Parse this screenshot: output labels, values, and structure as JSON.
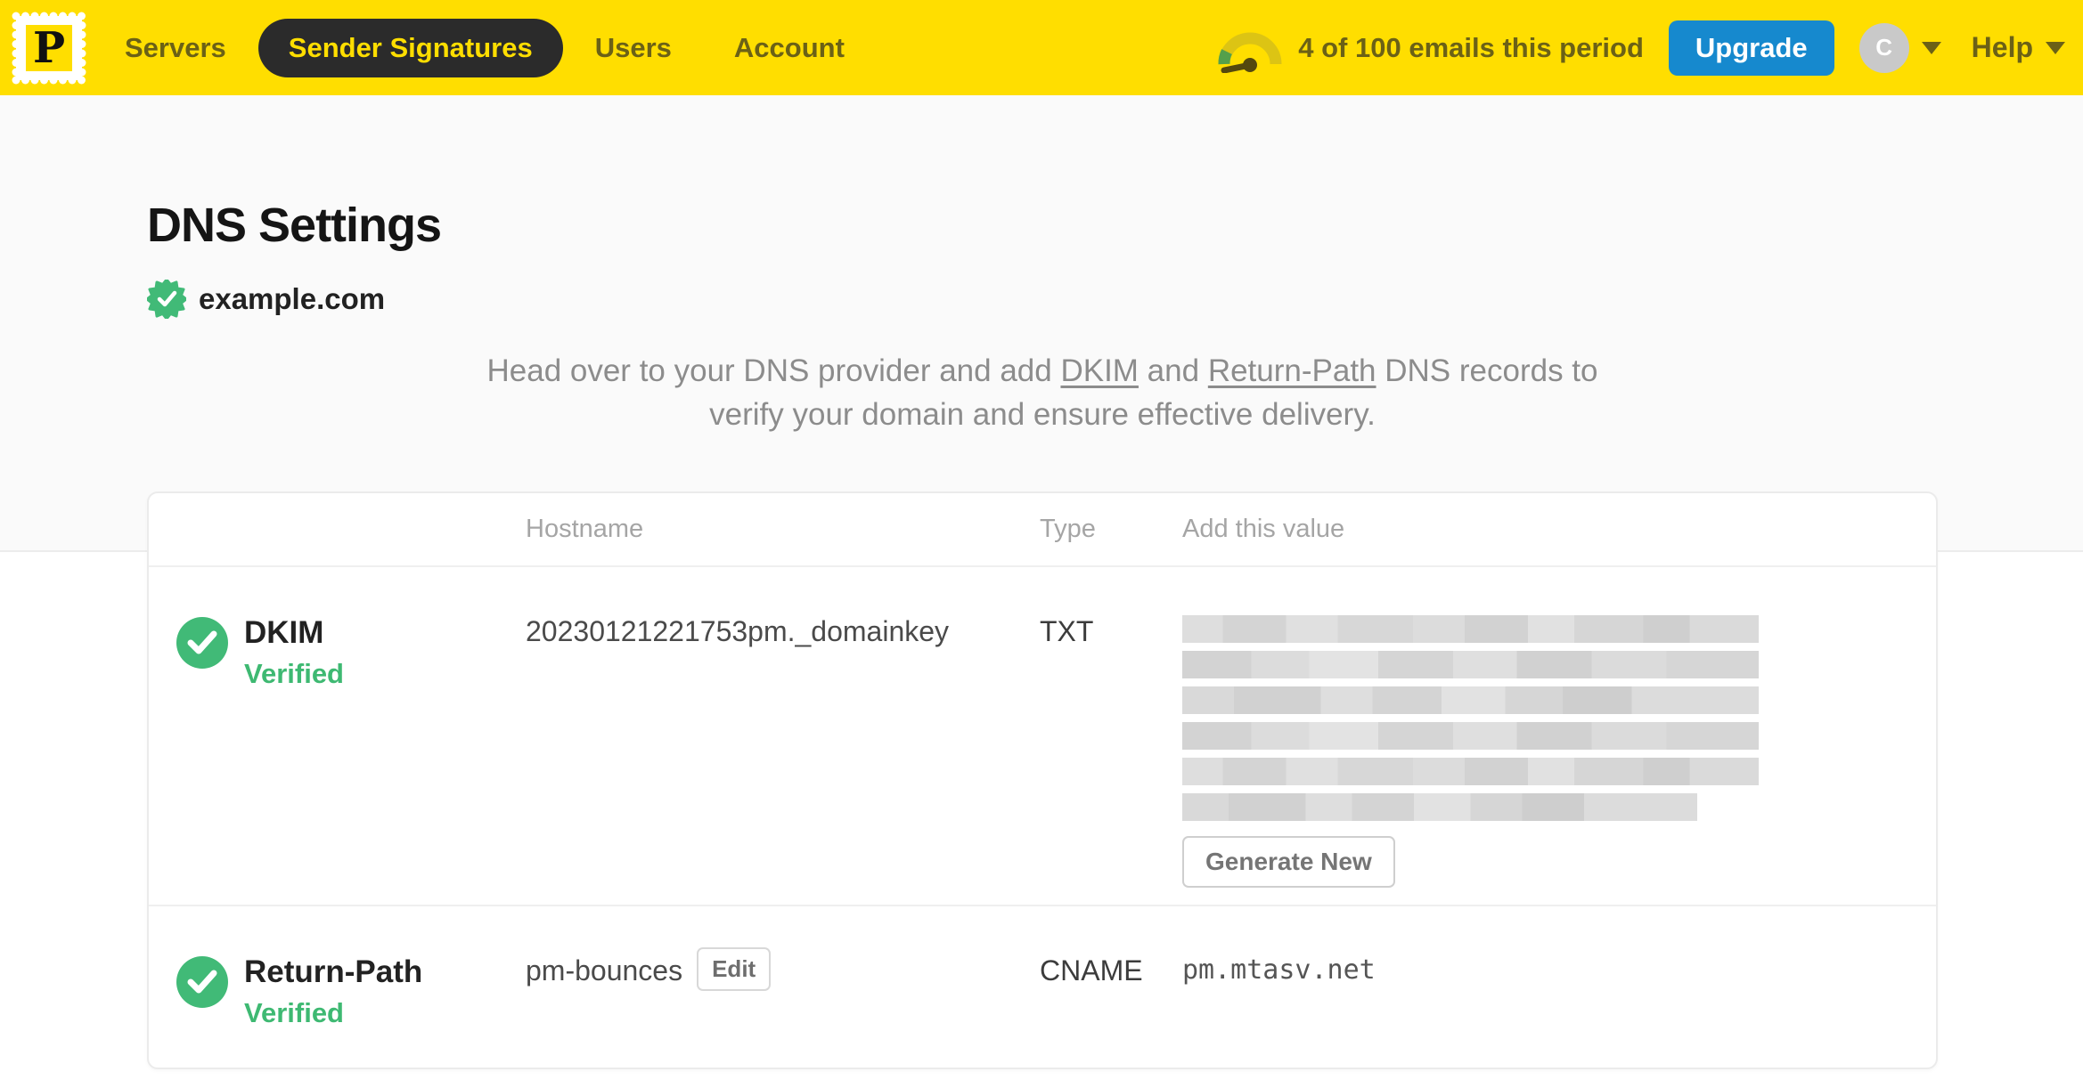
{
  "nav": {
    "logo_letter": "P",
    "items": [
      {
        "label": "Servers",
        "active": false
      },
      {
        "label": "Sender Signatures",
        "active": true
      },
      {
        "label": "Users",
        "active": false
      },
      {
        "label": "Account",
        "active": false
      }
    ],
    "usage_text": "4 of 100 emails this period",
    "upgrade_label": "Upgrade",
    "avatar_initial": "C",
    "help_label": "Help"
  },
  "page": {
    "title": "DNS Settings",
    "domain": "example.com",
    "instructions": {
      "part1": "Head over to your DNS provider and add ",
      "link1": "DKIM",
      "part2": " and ",
      "link2": "Return-Path",
      "part3": " DNS records to verify your domain and ensure effective delivery."
    }
  },
  "table": {
    "headers": [
      "Hostname",
      "Type",
      "Add this value"
    ],
    "rows": [
      {
        "name": "DKIM",
        "status": "Verified",
        "hostname": "20230121221753pm._domainkey",
        "type": "TXT",
        "value_redacted": true,
        "value_bar_count": 6,
        "action_label": "Generate New"
      },
      {
        "name": "Return-Path",
        "status": "Verified",
        "hostname": "pm-bounces",
        "edit_label": "Edit",
        "type": "CNAME",
        "value": "pm.mtasv.net"
      }
    ]
  },
  "colors": {
    "brand_yellow": "#FFDE00",
    "nav_text_olive": "#6B6116",
    "active_pill": "#2B2B2B",
    "upgrade_blue": "#1689CE",
    "success_green": "#41BA77",
    "redaction_gray": "#D6D6D6"
  }
}
